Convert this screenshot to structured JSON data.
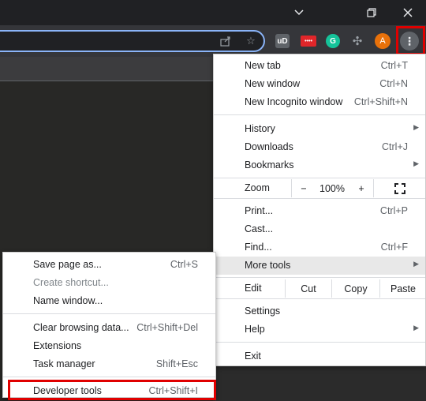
{
  "window_controls": {
    "chevron": "chevron-down",
    "restore": "restore",
    "close": "close"
  },
  "omnibox_icons": [
    "share-icon",
    "star-icon"
  ],
  "extensions": [
    {
      "name": "ublock-icon",
      "label": "uD",
      "color": "#8a8a8a"
    },
    {
      "name": "extension-red-icon",
      "label": "••••",
      "color": "#e0262a"
    },
    {
      "name": "grammarly-icon",
      "label": "G",
      "color": "#15c39a"
    },
    {
      "name": "puzzle-icon",
      "label": "",
      "color": "#9aa0a6"
    },
    {
      "name": "profile-avatar",
      "label": "A",
      "color": "#e8710a"
    }
  ],
  "menu": {
    "group1": [
      {
        "label": "New tab",
        "shortcut": "Ctrl+T"
      },
      {
        "label": "New window",
        "shortcut": "Ctrl+N"
      },
      {
        "label": "New Incognito window",
        "shortcut": "Ctrl+Shift+N"
      }
    ],
    "group2": [
      {
        "label": "History",
        "shortcut": ""
      },
      {
        "label": "Downloads",
        "shortcut": "Ctrl+J"
      },
      {
        "label": "Bookmarks",
        "shortcut": ""
      }
    ],
    "zoom": {
      "label": "Zoom",
      "minus": "−",
      "value": "100%",
      "plus": "+"
    },
    "group3": [
      {
        "label": "Print...",
        "shortcut": "Ctrl+P"
      },
      {
        "label": "Cast...",
        "shortcut": ""
      },
      {
        "label": "Find...",
        "shortcut": "Ctrl+F"
      },
      {
        "label": "More tools",
        "shortcut": ""
      }
    ],
    "edit": {
      "label": "Edit",
      "cut": "Cut",
      "copy": "Copy",
      "paste": "Paste"
    },
    "group4": [
      {
        "label": "Settings",
        "shortcut": ""
      },
      {
        "label": "Help",
        "shortcut": ""
      }
    ],
    "exit": "Exit"
  },
  "submenu": {
    "group1": [
      {
        "label": "Save page as...",
        "shortcut": "Ctrl+S"
      },
      {
        "label": "Create shortcut...",
        "shortcut": ""
      },
      {
        "label": "Name window...",
        "shortcut": ""
      }
    ],
    "group2": [
      {
        "label": "Clear browsing data...",
        "shortcut": "Ctrl+Shift+Del"
      },
      {
        "label": "Extensions",
        "shortcut": ""
      },
      {
        "label": "Task manager",
        "shortcut": "Shift+Esc"
      }
    ],
    "devtools": {
      "label": "Developer tools",
      "shortcut": "Ctrl+Shift+I"
    }
  },
  "colors": {
    "highlight_box": "#e00000",
    "focus_ring": "#8ab4f8",
    "hover_bg": "#e8e8e8"
  }
}
